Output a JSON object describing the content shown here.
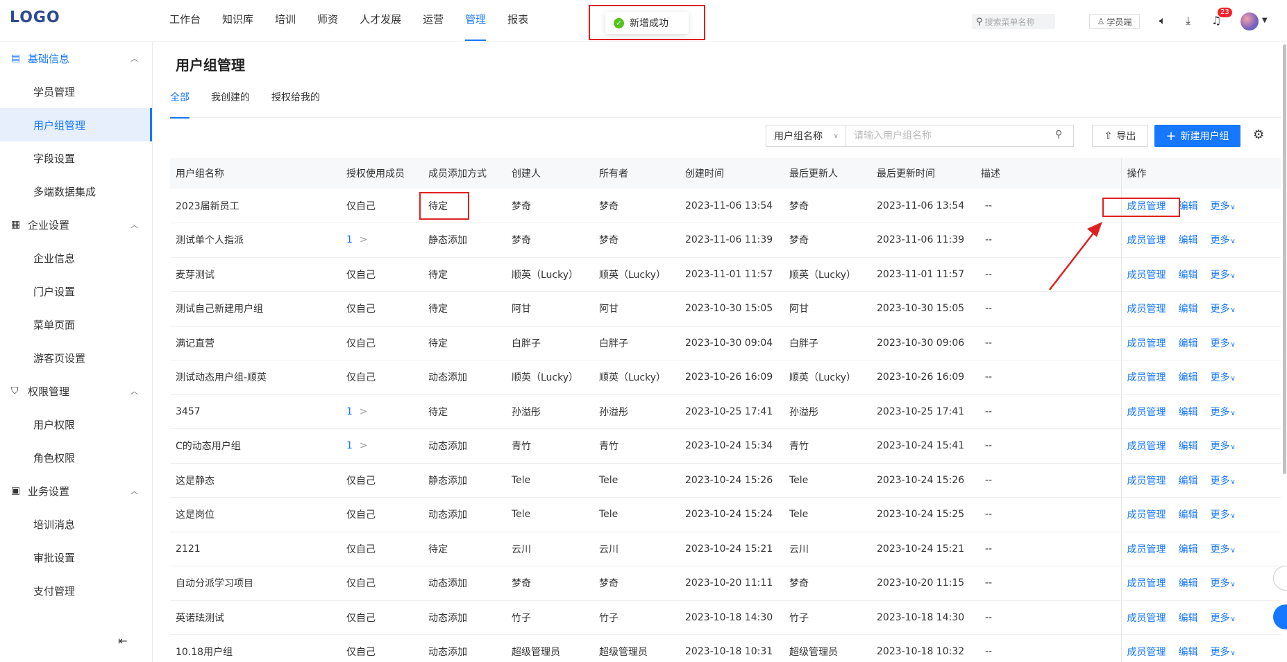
{
  "app": {
    "logo": "LOGO"
  },
  "topnav": {
    "items": [
      "工作台",
      "知识库",
      "培训",
      "师资",
      "人才发展",
      "运营",
      "管理",
      "报表"
    ],
    "active_index": 6,
    "search_placeholder": "搜索菜单名称",
    "student_btn": "学员端",
    "notification_count": "23"
  },
  "toast": {
    "message": "新增成功"
  },
  "sidebar": {
    "groups": [
      {
        "label": "基础信息",
        "icon": "book-icon",
        "items": [
          "学员管理",
          "用户组管理",
          "字段设置",
          "多端数据集成"
        ]
      },
      {
        "label": "企业设置",
        "icon": "building-icon",
        "items": [
          "企业信息",
          "门户设置",
          "菜单页面",
          "游客页设置"
        ]
      },
      {
        "label": "权限管理",
        "icon": "shield-icon",
        "items": [
          "用户权限",
          "角色权限"
        ]
      },
      {
        "label": "业务设置",
        "icon": "card-icon",
        "items": [
          "培训消息",
          "审批设置",
          "支付管理"
        ]
      }
    ],
    "active_item": "用户组管理"
  },
  "page": {
    "title": "用户组管理",
    "tabs": [
      "全部",
      "我创建的",
      "授权给我的"
    ],
    "active_tab": 0
  },
  "filter": {
    "field": "用户组名称",
    "placeholder": "请输入用户组名称",
    "export_label": "导出",
    "new_label": "新建用户组"
  },
  "table": {
    "headers": [
      "用户组名称",
      "授权使用成员",
      "成员添加方式",
      "创建人",
      "所有者",
      "创建时间",
      "最后更新人",
      "最后更新时间",
      "描述",
      "操作"
    ],
    "actions": [
      "成员管理",
      "编辑",
      "更多"
    ],
    "rows": [
      [
        "2023届新员工",
        "仅自己",
        "待定",
        "梦奇",
        "梦奇",
        "2023-11-06 13:54",
        "梦奇",
        "2023-11-06 13:54",
        "--"
      ],
      [
        "测试单个人指派",
        "1",
        "静态添加",
        "梦奇",
        "梦奇",
        "2023-11-06 11:39",
        "梦奇",
        "2023-11-06 11:39",
        "--"
      ],
      [
        "麦芽测试",
        "仅自己",
        "待定",
        "顺英（Lucky）",
        "顺英（Lucky）",
        "2023-11-01 11:57",
        "顺英（Lucky）",
        "2023-11-01 11:57",
        "--"
      ],
      [
        "测试自己新建用户组",
        "仅自己",
        "待定",
        "阿甘",
        "阿甘",
        "2023-10-30 15:05",
        "阿甘",
        "2023-10-30 15:05",
        "--"
      ],
      [
        "满记直营",
        "仅自己",
        "待定",
        "白胖子",
        "白胖子",
        "2023-10-30 09:04",
        "白胖子",
        "2023-10-30 09:06",
        "--"
      ],
      [
        "测试动态用户组-顺英",
        "仅自己",
        "动态添加",
        "顺英（Lucky）",
        "顺英（Lucky）",
        "2023-10-26 16:09",
        "顺英（Lucky）",
        "2023-10-26 16:09",
        "--"
      ],
      [
        "3457",
        "1",
        "待定",
        "孙溢彤",
        "孙溢彤",
        "2023-10-25 17:41",
        "孙溢彤",
        "2023-10-25 17:41",
        "--"
      ],
      [
        "C的动态用户组",
        "1",
        "动态添加",
        "青竹",
        "青竹",
        "2023-10-24 15:34",
        "青竹",
        "2023-10-24 15:41",
        "--"
      ],
      [
        "这是静态",
        "仅自己",
        "静态添加",
        "Tele",
        "Tele",
        "2023-10-24 15:26",
        "Tele",
        "2023-10-24 15:26",
        "--"
      ],
      [
        "这是岗位",
        "仅自己",
        "动态添加",
        "Tele",
        "Tele",
        "2023-10-24 15:24",
        "Tele",
        "2023-10-24 15:25",
        "--"
      ],
      [
        "2121",
        "仅自己",
        "待定",
        "云川",
        "云川",
        "2023-10-24 15:21",
        "云川",
        "2023-10-24 15:21",
        "--"
      ],
      [
        "自动分派学习项目",
        "仅自己",
        "动态添加",
        "梦奇",
        "梦奇",
        "2023-10-20 11:11",
        "梦奇",
        "2023-10-20 11:15",
        "--"
      ],
      [
        "英诺珐测试",
        "仅自己",
        "动态添加",
        "竹子",
        "竹子",
        "2023-10-18 14:30",
        "竹子",
        "2023-10-18 14:30",
        "--"
      ],
      [
        "10.18用户组",
        "仅自己",
        "动态添加",
        "超级管理员",
        "超级管理员",
        "2023-10-18 10:31",
        "超级管理员",
        "2023-10-18 10:32",
        "--"
      ]
    ]
  },
  "colors": {
    "primary": "#1677ff",
    "highlight": "#e02020",
    "success": "#52c41a"
  }
}
